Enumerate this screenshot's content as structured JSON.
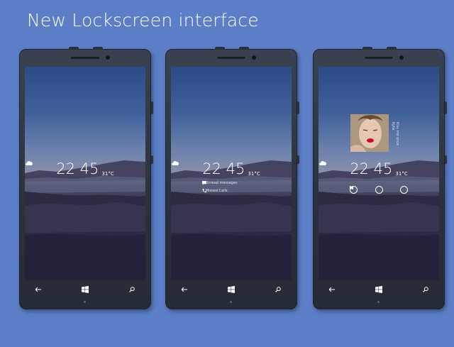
{
  "page": {
    "headline": "New Lockscreen interface",
    "background": "#5b7ec7"
  },
  "phones": [
    {
      "time": "22 45",
      "temperature": "31°C",
      "weather_icon": "cloud-icon"
    },
    {
      "time": "22 45",
      "temperature": "31°C",
      "weather_icon": "cloud-icon",
      "notifications": {
        "unread_messages": "2 Unread messages",
        "missed_calls": "3 Missed Calls"
      }
    },
    {
      "time": "22 45",
      "temperature": "31°C",
      "weather_icon": "cloud-icon",
      "media": {
        "song_title": "Kiss me once",
        "artist": "Kylie",
        "controls": [
          "previous-icon",
          "pause-icon",
          "next-icon"
        ]
      }
    }
  ],
  "nav": {
    "back_icon": "back-arrow-icon",
    "start_icon": "windows-start-icon",
    "search_icon": "search-icon"
  }
}
